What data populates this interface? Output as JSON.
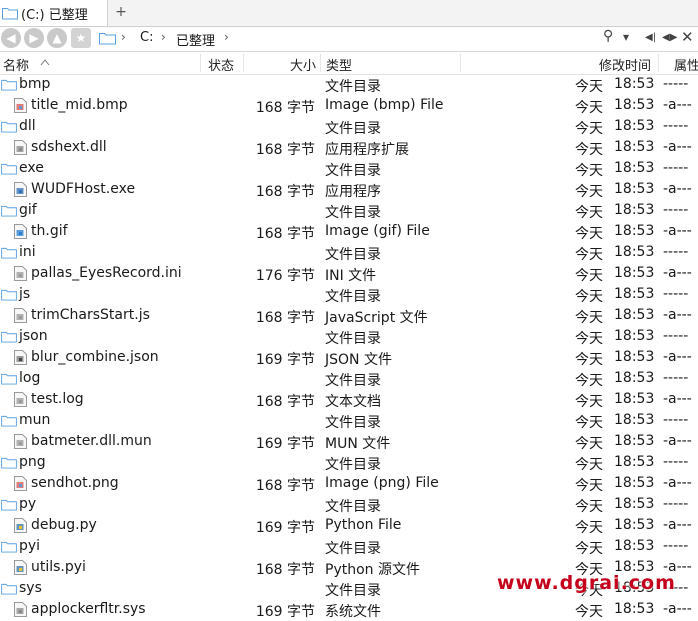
{
  "tab": {
    "title": "(C:) 已整理",
    "new_tab": "+"
  },
  "address": {
    "crumbs": [
      "C:",
      "已整理"
    ],
    "separator": "›",
    "search_glyph": "⚲",
    "dropdown_glyph": "▾"
  },
  "columns": {
    "name": "名称",
    "status": "状态",
    "size": "大小",
    "type": "类型",
    "modified": "修改时间",
    "attr": "属性"
  },
  "rows": [
    {
      "kind": "folder",
      "name": "bmp",
      "size": "",
      "type": "文件目录",
      "date": "今天",
      "time": "18:53",
      "attr": "-----"
    },
    {
      "kind": "file",
      "icon": "image",
      "name": "title_mid.bmp",
      "size": "168 字节",
      "type": "Image (bmp) File",
      "date": "今天",
      "time": "18:53",
      "attr": "-a---"
    },
    {
      "kind": "folder",
      "name": "dll",
      "size": "",
      "type": "文件目录",
      "date": "今天",
      "time": "18:53",
      "attr": "-----"
    },
    {
      "kind": "file",
      "icon": "gear",
      "name": "sdshext.dll",
      "size": "168 字节",
      "type": "应用程序扩展",
      "date": "今天",
      "time": "18:53",
      "attr": "-a---"
    },
    {
      "kind": "folder",
      "name": "exe",
      "size": "",
      "type": "文件目录",
      "date": "今天",
      "time": "18:53",
      "attr": "-----"
    },
    {
      "kind": "file",
      "icon": "window",
      "name": "WUDFHost.exe",
      "size": "168 字节",
      "type": "应用程序",
      "date": "今天",
      "time": "18:53",
      "attr": "-a---"
    },
    {
      "kind": "folder",
      "name": "gif",
      "size": "",
      "type": "文件目录",
      "date": "今天",
      "time": "18:53",
      "attr": "-----"
    },
    {
      "kind": "file",
      "icon": "gif",
      "name": "th.gif",
      "size": "168 字节",
      "type": "Image (gif) File",
      "date": "今天",
      "time": "18:53",
      "attr": "-a---"
    },
    {
      "kind": "folder",
      "name": "ini",
      "size": "",
      "type": "文件目录",
      "date": "今天",
      "time": "18:53",
      "attr": "-----"
    },
    {
      "kind": "file",
      "icon": "text",
      "name": "pallas_EyesRecord.ini",
      "size": "176 字节",
      "type": "INI 文件",
      "date": "今天",
      "time": "18:53",
      "attr": "-a---"
    },
    {
      "kind": "folder",
      "name": "js",
      "size": "",
      "type": "文件目录",
      "date": "今天",
      "time": "18:53",
      "attr": "-----"
    },
    {
      "kind": "file",
      "icon": "text",
      "name": "trimCharsStart.js",
      "size": "168 字节",
      "type": "JavaScript 文件",
      "date": "今天",
      "time": "18:53",
      "attr": "-a---"
    },
    {
      "kind": "folder",
      "name": "json",
      "size": "",
      "type": "文件目录",
      "date": "今天",
      "time": "18:53",
      "attr": "-----"
    },
    {
      "kind": "file",
      "icon": "json",
      "name": "blur_combine.json",
      "size": "169 字节",
      "type": "JSON 文件",
      "date": "今天",
      "time": "18:53",
      "attr": "-a---"
    },
    {
      "kind": "folder",
      "name": "log",
      "size": "",
      "type": "文件目录",
      "date": "今天",
      "time": "18:53",
      "attr": "-----"
    },
    {
      "kind": "file",
      "icon": "text",
      "name": "test.log",
      "size": "168 字节",
      "type": "文本文档",
      "date": "今天",
      "time": "18:53",
      "attr": "-a---"
    },
    {
      "kind": "folder",
      "name": "mun",
      "size": "",
      "type": "文件目录",
      "date": "今天",
      "time": "18:53",
      "attr": "-----"
    },
    {
      "kind": "file",
      "icon": "text",
      "name": "batmeter.dll.mun",
      "size": "169 字节",
      "type": "MUN 文件",
      "date": "今天",
      "time": "18:53",
      "attr": "-a---"
    },
    {
      "kind": "folder",
      "name": "png",
      "size": "",
      "type": "文件目录",
      "date": "今天",
      "time": "18:53",
      "attr": "-----"
    },
    {
      "kind": "file",
      "icon": "image",
      "name": "sendhot.png",
      "size": "168 字节",
      "type": "Image (png) File",
      "date": "今天",
      "time": "18:53",
      "attr": "-a---"
    },
    {
      "kind": "folder",
      "name": "py",
      "size": "",
      "type": "文件目录",
      "date": "今天",
      "time": "18:53",
      "attr": "-----"
    },
    {
      "kind": "file",
      "icon": "python",
      "name": "debug.py",
      "size": "169 字节",
      "type": "Python File",
      "date": "今天",
      "time": "18:53",
      "attr": "-a---"
    },
    {
      "kind": "folder",
      "name": "pyi",
      "size": "",
      "type": "文件目录",
      "date": "今天",
      "time": "18:53",
      "attr": "-----"
    },
    {
      "kind": "file",
      "icon": "python",
      "name": "utils.pyi",
      "size": "168 字节",
      "type": "Python 源文件",
      "date": "今天",
      "time": "18:53",
      "attr": "-a---"
    },
    {
      "kind": "folder",
      "name": "sys",
      "size": "",
      "type": "文件目录",
      "date": "今天",
      "time": "18:53",
      "attr": "-----"
    },
    {
      "kind": "file",
      "icon": "gear",
      "name": "applockerfltr.sys",
      "size": "169 字节",
      "type": "系统文件",
      "date": "今天",
      "time": "18:53",
      "attr": "-a---"
    }
  ],
  "watermark": "www.dgrai.com",
  "colors": {
    "folder": "#5aa0e0",
    "accent": "#0078d7",
    "watermark": "#c4001a"
  }
}
